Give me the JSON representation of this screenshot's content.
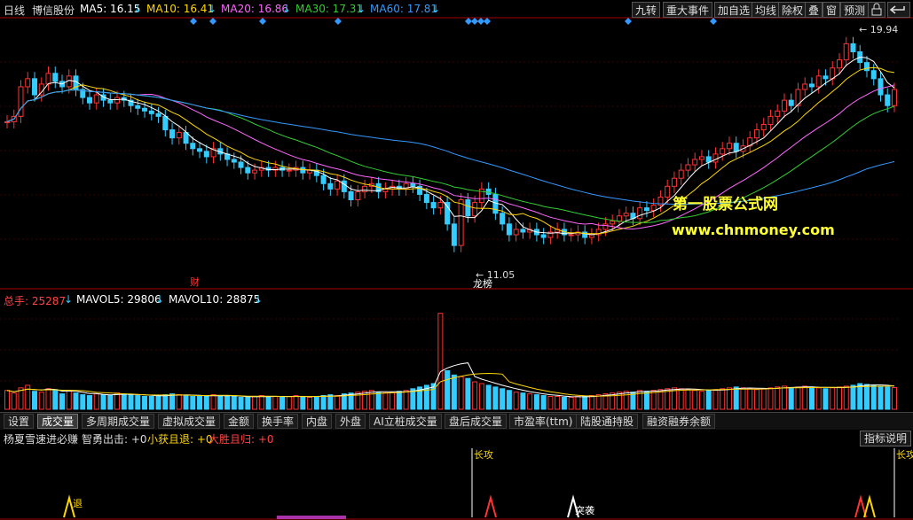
{
  "header": {
    "period": "日线",
    "stock_name": "博信股份",
    "ma5": {
      "label": "MA5: 16.15",
      "color": "#ffffff"
    },
    "ma10": {
      "label": "MA10: 16.41",
      "color": "#ffd700"
    },
    "ma20": {
      "label": "MA20: 16.86",
      "color": "#ff66ff"
    },
    "ma30": {
      "label": "MA30: 17.31",
      "color": "#33cc33"
    },
    "ma60": {
      "label": "MA60: 17.81",
      "color": "#3399ff"
    },
    "down_arrow": "↓"
  },
  "toolbar": {
    "buttons": [
      "九转",
      "重大事件",
      "加自选",
      "均线",
      "除权",
      "叠",
      "窗",
      "预测"
    ],
    "icons": [
      "lock-icon",
      "back-icon"
    ]
  },
  "price_chart": {
    "high_label": "19.94",
    "low_label": "11.05",
    "marker_cai": "财",
    "marker_long": "龙榜"
  },
  "watermark": {
    "line1": "第一股票公式网",
    "line2": "www.chnmoney.com"
  },
  "volume_header": {
    "total": "总手: 25287",
    "mavol5": "MAVOL5: 29806",
    "mavol10": "MAVOL10: 28875",
    "arrow": "↓"
  },
  "tabs": [
    "设置",
    "成交量",
    "多周期成交量",
    "虚拟成交量",
    "金额",
    "换手率",
    "内盘",
    "外盘",
    "AI立桩成交量",
    "盘后成交量",
    "市盈率(ttm)",
    "陆股通持股",
    "融资融券余额"
  ],
  "indicator_header": {
    "name": "杨夏雪速进必赚",
    "sig1": "智勇出击: +0",
    "sig2": "小获且退: +0",
    "sig3": "大胜且归: +0"
  },
  "indicator_help": "指标说明",
  "indicator_labels": {
    "long_attack": "长攻",
    "retreat": "退",
    "breakout": "突袭"
  },
  "colors": {
    "up": "#ff3333",
    "down": "#33ccff",
    "border": "#aa0000",
    "accent": "#ff3333"
  },
  "chart_data": {
    "type": "candlestick",
    "ylim": [
      11.05,
      19.94
    ],
    "volume_ylim": [
      0,
      120000
    ],
    "candles_close": [
      16.6,
      16.8,
      17.9,
      18.2,
      17.6,
      18.0,
      18.4,
      18.1,
      17.9,
      18.3,
      17.8,
      17.5,
      17.3,
      17.6,
      17.4,
      17.3,
      17.5,
      17.4,
      17.2,
      17.1,
      17.0,
      16.9,
      16.8,
      16.3,
      16.0,
      16.2,
      15.8,
      15.6,
      15.5,
      15.3,
      15.6,
      15.4,
      15.2,
      15.1,
      14.9,
      14.7,
      14.8,
      14.9,
      14.8,
      14.9,
      14.8,
      14.8,
      14.9,
      14.7,
      14.8,
      14.6,
      14.3,
      14.1,
      14.4,
      14.0,
      13.7,
      14.0,
      14.2,
      14.3,
      14.0,
      14.1,
      14.2,
      14.1,
      14.3,
      14.2,
      13.9,
      13.6,
      13.4,
      13.6,
      12.8,
      12.0,
      13.7,
      13.1,
      13.6,
      14.1,
      13.9,
      13.2,
      12.8,
      12.4,
      12.6,
      12.5,
      12.6,
      12.4,
      12.3,
      12.5,
      12.6,
      12.4,
      12.4,
      12.5,
      12.3,
      12.4,
      12.6,
      12.8,
      12.9,
      13.1,
      13.2,
      13.0,
      13.4,
      13.3,
      13.5,
      13.8,
      14.2,
      14.5,
      14.8,
      15.0,
      15.2,
      15.3,
      15.1,
      15.4,
      15.6,
      15.8,
      15.5,
      15.7,
      16.0,
      16.3,
      16.5,
      16.8,
      17.0,
      17.4,
      17.2,
      17.8,
      18.0,
      17.9,
      18.3,
      18.2,
      18.6,
      18.9,
      19.5,
      19.2,
      18.8,
      18.5,
      18.2,
      17.6,
      17.2,
      17.8
    ],
    "volume": [
      22000,
      19000,
      25000,
      28000,
      21000,
      20000,
      24000,
      23000,
      18000,
      22000,
      19000,
      17000,
      16000,
      18000,
      17000,
      16000,
      19000,
      18000,
      17000,
      16000,
      15000,
      15000,
      16000,
      17000,
      18000,
      17000,
      16000,
      15000,
      15000,
      16000,
      17000,
      16000,
      15000,
      15000,
      14000,
      14000,
      15000,
      16000,
      15000,
      15000,
      14000,
      15000,
      16000,
      15000,
      14000,
      15000,
      16000,
      17000,
      16000,
      18000,
      19000,
      20000,
      21000,
      22000,
      20000,
      19000,
      20000,
      21000,
      22000,
      24000,
      26000,
      28000,
      30000,
      112000,
      45000,
      40000,
      38000,
      36000,
      32000,
      30000,
      28000,
      26000,
      24000,
      22000,
      20000,
      19000,
      18000,
      17000,
      16000,
      15000,
      15000,
      14000,
      14000,
      15000,
      15000,
      16000,
      17000,
      18000,
      19000,
      20000,
      21000,
      20000,
      22000,
      21000,
      22000,
      23000,
      24000,
      25000,
      24000,
      23000,
      22000,
      21000,
      22000,
      23000,
      24000,
      25000,
      26000,
      25000,
      24000,
      23000,
      24000,
      25000,
      26000,
      27000,
      25000,
      26000,
      27000,
      26000,
      25000,
      24000,
      25000,
      26000,
      27000,
      28000,
      30000,
      29000,
      28000,
      27000,
      26000,
      25287
    ]
  }
}
